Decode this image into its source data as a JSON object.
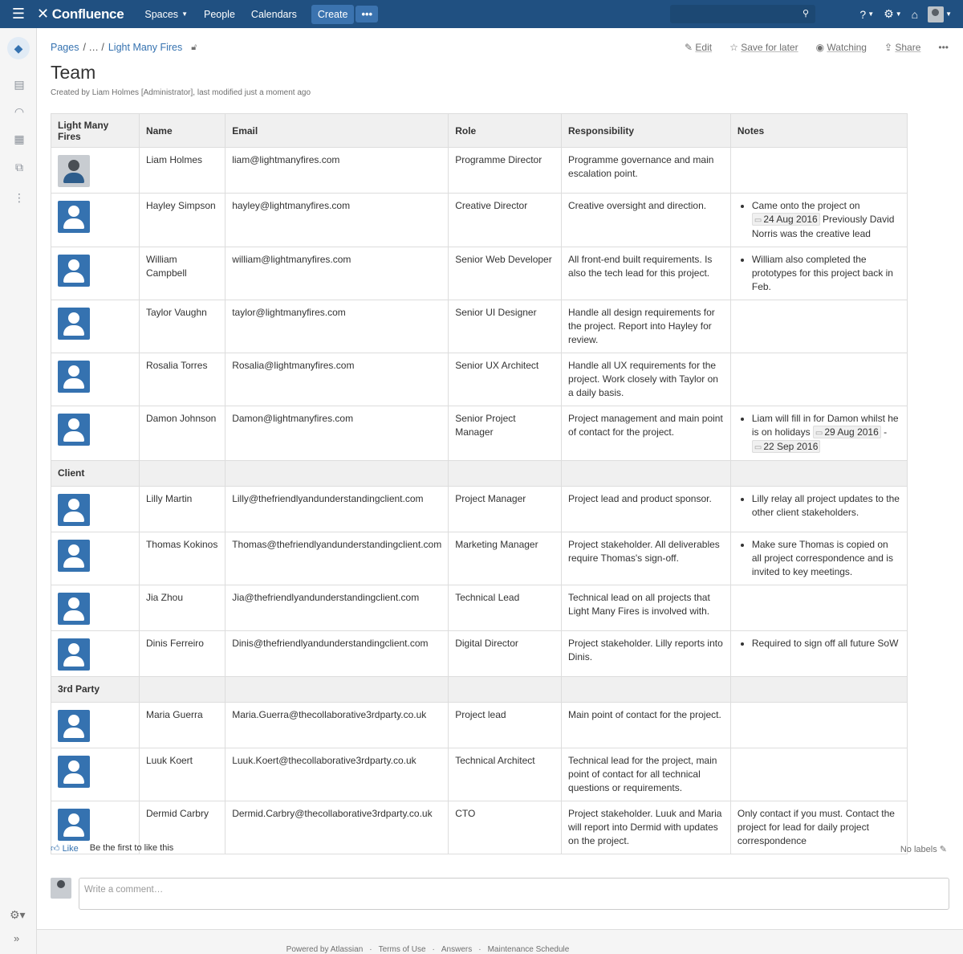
{
  "nav": {
    "app_name": "Confluence",
    "spaces": "Spaces",
    "people": "People",
    "calendars": "Calendars",
    "create": "Create",
    "more": "•••"
  },
  "breadcrumb": {
    "pages": "Pages",
    "ellipsis": "/ … /",
    "current": "Light Many Fires"
  },
  "actions": {
    "edit": "Edit",
    "save_for_later": "Save for later",
    "watching": "Watching",
    "share": "Share"
  },
  "page": {
    "title": "Team",
    "meta": "Created by Liam Holmes [Administrator], last modified just a moment ago"
  },
  "table": {
    "headers": [
      "Light Many Fires",
      "Name",
      "Email",
      "Role",
      "Responsibility",
      "Notes"
    ],
    "sections": [
      {
        "label": null,
        "rows": [
          {
            "name": "Liam Holmes",
            "email": "liam@lightmanyfires.com",
            "role": "Programme Director",
            "responsibility": "Programme governance and main escalation point.",
            "notes": ""
          },
          {
            "name": "Hayley Simpson",
            "email": "hayley@lightmanyfires.com",
            "role": "Creative Director",
            "responsibility": "Creative oversight and direction.",
            "notes": ""
          },
          {
            "name": "William Campbell",
            "email": "william@lightmanyfires.com",
            "role": "Senior Web Developer",
            "responsibility": "All front-end built requirements. Is also the tech lead for this project.",
            "notes": "William also completed the prototypes for this project back in Feb."
          },
          {
            "name": "Taylor Vaughn",
            "email": "taylor@lightmanyfires.com",
            "role": "Senior UI Designer",
            "responsibility": "Handle all design requirements for the project. Report into Hayley for review.",
            "notes": ""
          },
          {
            "name": "Rosalia Torres",
            "email": "Rosalia@lightmanyfires.com",
            "role": "Senior UX Architect",
            "responsibility": "Handle all UX requirements for the project. Work closely with Taylor on a daily basis.",
            "notes": ""
          },
          {
            "name": "Damon Johnson",
            "email": "Damon@lightmanyfires.com",
            "role": "Senior Project Manager",
            "responsibility": "Project management and main point of contact for the project.",
            "notes": ""
          }
        ]
      },
      {
        "label": "Client",
        "rows": [
          {
            "name": "Lilly Martin",
            "email": "Lilly@thefriendlyandunderstandingclient.com",
            "role": "Project Manager",
            "responsibility": "Project lead and product sponsor.",
            "notes": "Lilly relay all project updates to the other client stakeholders."
          },
          {
            "name": "Thomas Kokinos",
            "email": "Thomas@thefriendlyandunderstandingclient.com",
            "role": "Marketing Manager",
            "responsibility": "Project stakeholder. All deliverables require Thomas's sign-off.",
            "notes": "Make sure Thomas is copied on all project correspondence and is invited to key meetings."
          },
          {
            "name": "Jia Zhou",
            "email": "Jia@thefriendlyandunderstandingclient.com",
            "role": "Technical Lead",
            "responsibility": "Technical lead on all projects that Light Many Fires is involved with.",
            "notes": ""
          },
          {
            "name": "Dinis Ferreiro",
            "email": "Dinis@thefriendlyandunderstandingclient.com",
            "role": "Digital Director",
            "responsibility": "Project stakeholder. Lilly reports into Dinis.",
            "notes": "Required to sign off all future SoW"
          }
        ]
      },
      {
        "label": "3rd Party",
        "rows": [
          {
            "name": "Maria Guerra",
            "email": "Maria.Guerra@thecollaborative3rdparty.co.uk",
            "role": "Project lead",
            "responsibility": "Main point of contact for the project.",
            "notes": ""
          },
          {
            "name": "Luuk Koert",
            "email": "Luuk.Koert@thecollaborative3rdparty.co.uk",
            "role": "Technical Architect",
            "responsibility": "Technical lead for the project, main point of contact for all technical questions or requirements.",
            "notes": ""
          },
          {
            "name": "Dermid Carbry",
            "email": "Dermid.Carbry@thecollaborative3rdparty.co.uk",
            "role": "CTO",
            "responsibility": "Project stakeholder. Luuk and Maria will report into Dermid with updates on the project.",
            "notes_plain": "Only contact if you must. Contact the project for lead for daily project correspondence"
          }
        ]
      }
    ],
    "hayley_note": {
      "pre": "Came onto the project on",
      "date": "24 Aug 2016",
      "post": "Previously David Norris was the creative lead"
    },
    "damon_note": {
      "pre": "Liam will fill in for Damon whilst he is on holidays",
      "date1": "29 Aug 2016",
      "dash": "-",
      "date2": "22 Sep 2016"
    }
  },
  "like": {
    "label": "Like",
    "text": "Be the first to like this"
  },
  "labels": "No labels",
  "comment": {
    "placeholder": "Write a comment…"
  },
  "footer": {
    "items": [
      "Powered by Atlassian",
      "·",
      "Terms of Use",
      "·",
      "Answers",
      "·",
      "Maintenance Schedule"
    ]
  }
}
